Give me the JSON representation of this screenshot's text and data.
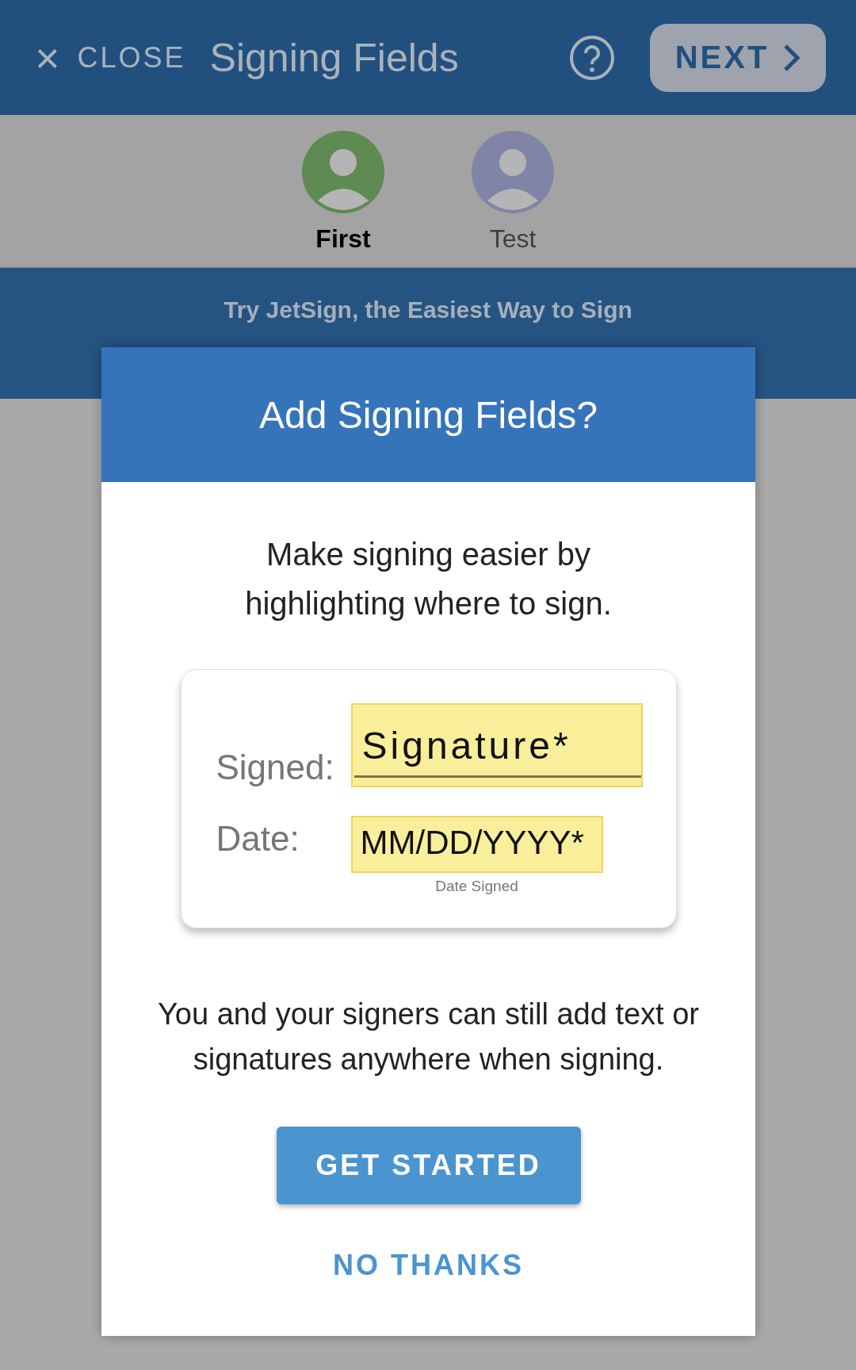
{
  "top_bar": {
    "close_icon": "×",
    "close_label": "CLOSE",
    "title": "Signing Fields",
    "next_label": "NEXT"
  },
  "signers": [
    {
      "name": "First",
      "selected": true,
      "color": "#5f8a52"
    },
    {
      "name": "Test",
      "selected": false,
      "color": "#8085a8"
    }
  ],
  "banner": {
    "text": "Try JetSign, the Easiest Way to Sign"
  },
  "dialog": {
    "title": "Add Signing Fields?",
    "intro": "Make signing easier by highlighting where to sign.",
    "example": {
      "signed_label": "Signed:",
      "signature_field": "Signature*",
      "date_label": "Date:",
      "date_field": "MM/DD/YYYY*",
      "date_caption": "Date Signed"
    },
    "note": "You and your signers can still add text or signatures anywhere when signing.",
    "primary_button": "GET STARTED",
    "secondary_button": "NO THANKS"
  }
}
